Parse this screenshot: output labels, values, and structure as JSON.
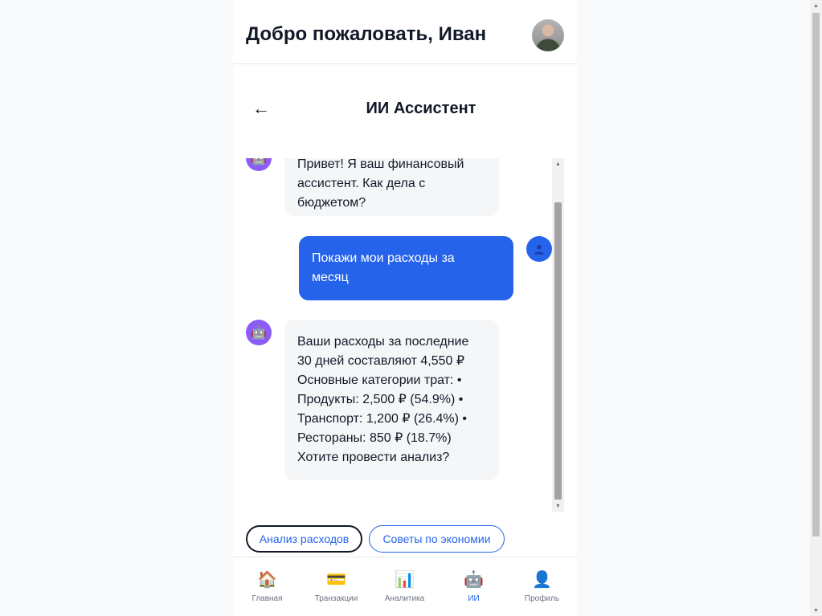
{
  "header": {
    "title": "Добро пожаловать, Иван"
  },
  "assistant": {
    "back_icon": "←",
    "title": "ИИ Ассистент"
  },
  "messages": [
    {
      "from": "bot",
      "text": "Привет! Я ваш финансовый\nассистент. Как дела с\nбюджетом?"
    },
    {
      "from": "user",
      "text": "Покажи мои расходы за\nмесяц"
    },
    {
      "from": "bot",
      "text": "Ваши расходы за последние\n30 дней составляют 4,550 ₽\nОсновные категории трат: •\nПродукты: 2,500 ₽ (54.9%) •\nТранспорт: 1,200 ₽ (26.4%) •\nРестораны: 850 ₽ (18.7%)\nХотите провести анализ?"
    }
  ],
  "bot_avatar_icon": "🤖",
  "quick_replies": [
    "Анализ расходов",
    "Советы по экономии"
  ],
  "nav": [
    {
      "icon": "🏠",
      "label": "Главная"
    },
    {
      "icon": "💳",
      "label": "Транзакции"
    },
    {
      "icon": "📊",
      "label": "Аналитика"
    },
    {
      "icon": "🤖",
      "label": "ИИ",
      "active": true
    },
    {
      "icon": "👤",
      "label": "Профиль"
    }
  ],
  "colors": {
    "primary": "#2563eb",
    "bot_bubble": "#f5f6f8",
    "bot_avatar": "#8b5cf6"
  }
}
